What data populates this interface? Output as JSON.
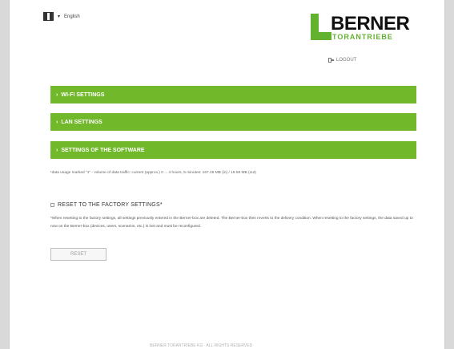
{
  "header": {
    "language": "English",
    "brand": {
      "title": "BERNER",
      "subtitle": "TORANTRIEBE"
    },
    "logout": "LOGOUT"
  },
  "sections": [
    {
      "label": "WI-FI SETTINGS"
    },
    {
      "label": "LAN SETTINGS"
    },
    {
      "label": "SETTINGS OF THE SOFTWARE"
    }
  ],
  "note": "¹data usage marked \"1\" - volume of data traffic: current (approx.) 0 ... 4 hours, 5 minutes: 167.48 MB (in) / 19.59 MB (out)",
  "reset": {
    "heading": "RESET TO THE FACTORY SETTINGS*",
    "text": "*When resetting to the factory settings, all settings previously entered in the Berner-box are deleted. The Berner-box then reverts to the delivery condition. When resetting to the factory settings, the data saved up to now on the Berner-box (devices, users, scenarios, etc.) is lost and must be reconfigured.",
    "button": "RESET"
  },
  "footer": {
    "text": "BERNER TORANTRIEBE KG · ALL RIGHTS RESERVED"
  },
  "colors": {
    "accent": "#71b92a",
    "brand_green": "#63b22f",
    "background": "#d9d9d9",
    "page": "#ffffff"
  },
  "icons": {
    "flag": "flag-icon",
    "dropdown": "chevron-down-icon",
    "logout": "logout-icon",
    "section_chevron": "chevron-right-icon",
    "checkbox": "checkbox-icon"
  }
}
